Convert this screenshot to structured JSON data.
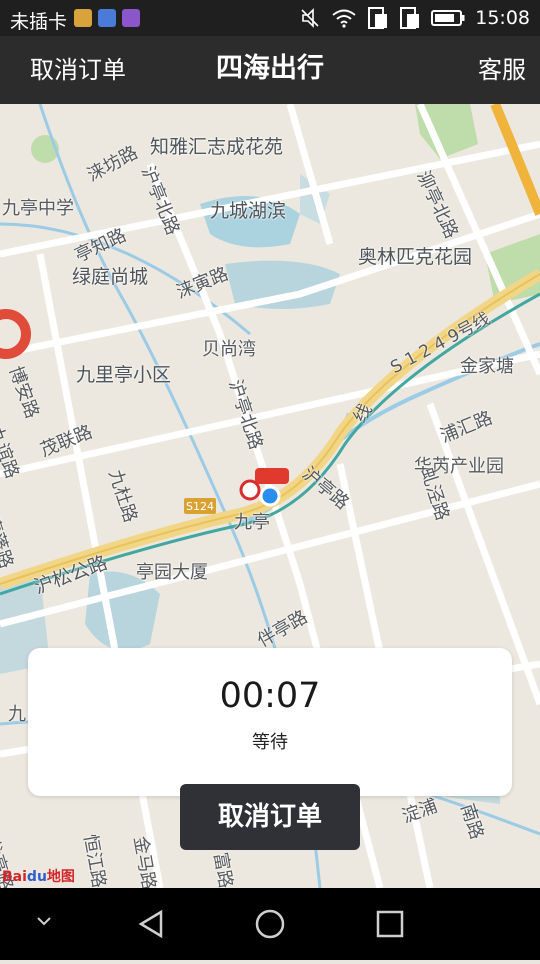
{
  "status_bar": {
    "carrier": "未插卡",
    "time": "15:08",
    "app_icon_colors": [
      "#d9a33c",
      "#4a7bd8",
      "#8a56c9"
    ]
  },
  "header": {
    "left_action": "取消订单",
    "title": "四海出行",
    "right_action": "客服"
  },
  "map": {
    "labels": [
      {
        "text": "知雅汇志成花苑",
        "cls": "big"
      },
      {
        "text": "九亭中学"
      },
      {
        "text": "泖亭北路",
        "cls": "rot"
      },
      {
        "text": "涞坊路",
        "cls": "rot"
      },
      {
        "text": "沪亭北路",
        "cls": "rot"
      },
      {
        "text": "九城湖滨",
        "cls": "big"
      },
      {
        "text": "奥林匹克花园",
        "cls": "big"
      },
      {
        "text": "亭知路",
        "cls": "rot"
      },
      {
        "text": "绿庭尚城",
        "cls": "big"
      },
      {
        "text": "涞寅路",
        "cls": "rot"
      },
      {
        "text": "贝尚湾"
      },
      {
        "text": "S 1 2 4 9号线",
        "cls": "rot"
      },
      {
        "text": "金家塘"
      },
      {
        "text": "博安路",
        "cls": "rot"
      },
      {
        "text": "九里亭小区",
        "cls": "big"
      },
      {
        "text": "沪亭北路",
        "cls": "rot"
      },
      {
        "text": "九谊路",
        "cls": "rot"
      },
      {
        "text": "茂联路",
        "cls": "rot"
      },
      {
        "text": "浦汇路",
        "cls": "rot"
      },
      {
        "text": "华芮产业园"
      },
      {
        "text": "九杜路",
        "cls": "rot"
      },
      {
        "text": "沪亭路",
        "cls": "rot"
      },
      {
        "text": "虬泾路",
        "cls": "rot"
      },
      {
        "text": "嘉蓬路",
        "cls": "rot"
      },
      {
        "text": "九亭"
      },
      {
        "text": "沪松公路",
        "cls": "rot"
      },
      {
        "text": "亭园大厦"
      },
      {
        "text": "伴亭路",
        "cls": "rot"
      },
      {
        "text": "九",
        "cls": ""
      },
      {
        "text": "龙高路",
        "cls": "rot"
      },
      {
        "text": "恒江路",
        "cls": "rot"
      },
      {
        "text": "金马路",
        "cls": "rot"
      },
      {
        "text": "富路",
        "cls": "rot"
      },
      {
        "text": "淀浦",
        "cls": "rot"
      },
      {
        "text": "南路",
        "cls": "rot"
      },
      {
        "text": "线",
        "cls": "rot"
      }
    ],
    "road_shield": "S124",
    "logo_bai": "Bai",
    "logo_du": "du",
    "logo_map": "地图"
  },
  "order_card": {
    "timer": "00:07",
    "status": "等待"
  },
  "cancel_button": {
    "label": "取消订单"
  }
}
